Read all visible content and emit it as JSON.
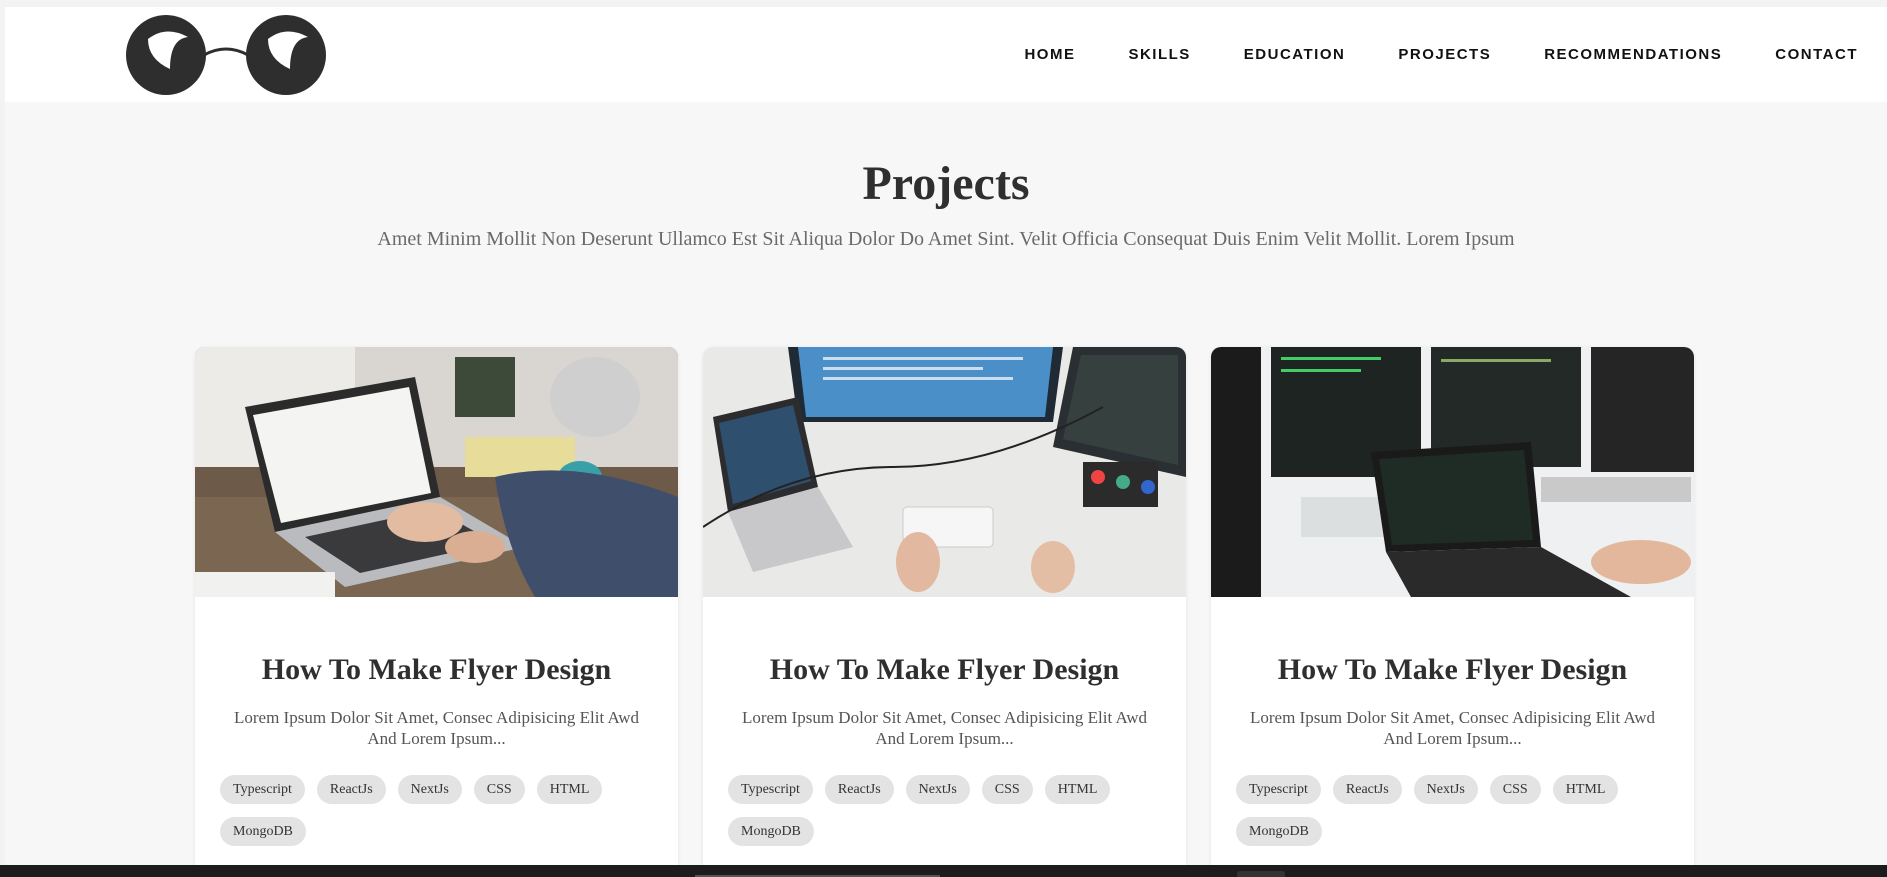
{
  "nav": {
    "items": [
      "HOME",
      "SKILLS",
      "EDUCATION",
      "PROJECTS",
      "RECOMMENDATIONS",
      "CONTACT"
    ]
  },
  "logo": {
    "icon": "round-glasses-icon",
    "color": "#2e2e2e"
  },
  "projects": {
    "title": "Projects",
    "subtitle": "Amet Minim Mollit Non Deserunt Ullamco Est Sit Aliqua Dolor Do Amet Sint. Velit Officia Consequat Duis Enim Velit Mollit. Lorem Ipsum",
    "cards": [
      {
        "image": "laptop-desk-photo",
        "title": "How To Make Flyer Design",
        "description": "Lorem Ipsum Dolor Sit Amet, Consec Adipisicing Elit Awd And Lorem Ipsum...",
        "tags": [
          "Typescript",
          "ReactJs",
          "NextJs",
          "CSS",
          "HTML",
          "MongoDB"
        ]
      },
      {
        "image": "multi-monitor-desk-photo",
        "title": "How To Make Flyer Design",
        "description": "Lorem Ipsum Dolor Sit Amet, Consec Adipisicing Elit Awd And Lorem Ipsum...",
        "tags": [
          "Typescript",
          "ReactJs",
          "NextJs",
          "CSS",
          "HTML",
          "MongoDB"
        ]
      },
      {
        "image": "coding-laptop-monitors-photo",
        "title": "How To Make Flyer Design",
        "description": "Lorem Ipsum Dolor Sit Amet, Consec Adipisicing Elit Awd And Lorem Ipsum...",
        "tags": [
          "Typescript",
          "ReactJs",
          "NextJs",
          "CSS",
          "HTML",
          "MongoDB"
        ]
      }
    ]
  },
  "colors": {
    "background": "#f7f7f7",
    "card": "#ffffff",
    "tag": "#e3e3e3",
    "heading": "#2f2f2f"
  }
}
